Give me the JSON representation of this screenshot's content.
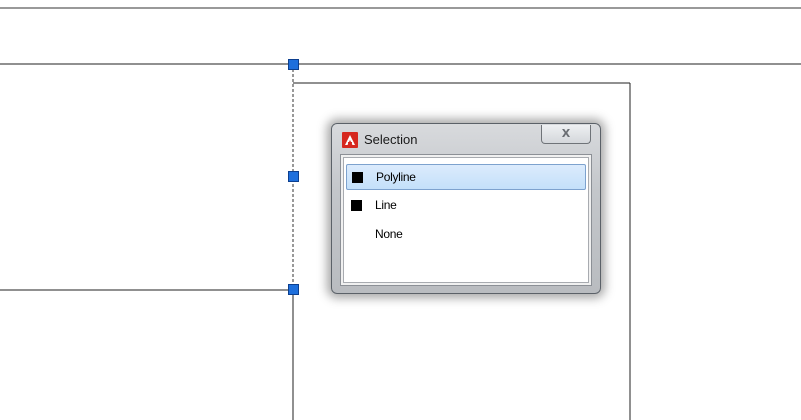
{
  "dialog": {
    "title": "Selection",
    "close_glyph": "X",
    "app_icon": "autocad-icon",
    "items": [
      {
        "label": "Polyline",
        "swatch": true,
        "selected": true
      },
      {
        "label": "Line",
        "swatch": true,
        "selected": false
      },
      {
        "label": "None",
        "swatch": false,
        "selected": false
      }
    ]
  },
  "colors": {
    "grip": "#1e6fdc",
    "selection_highlight": "#c4e0fa",
    "app_icon": "#d6281f",
    "swatch": "#000000"
  }
}
